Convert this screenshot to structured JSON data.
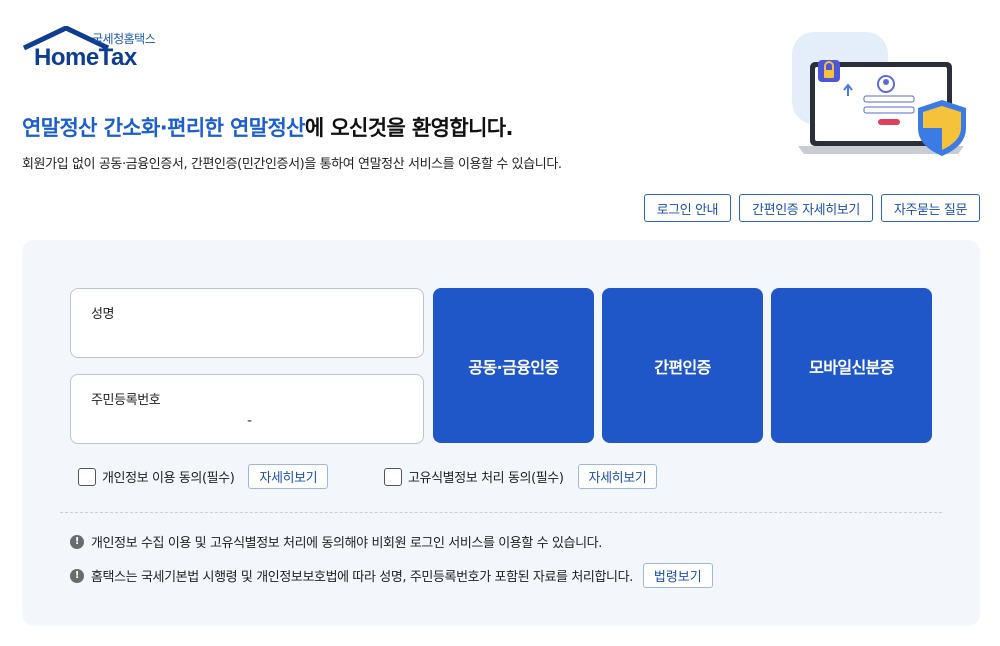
{
  "logo": {
    "sub": "국세청홈택스",
    "main": "HomeTax"
  },
  "header": {
    "headline_accent": "연말정산 간소화·편리한 연말정산",
    "headline_rest": "에 오신것을 환영합니다.",
    "subline": "회원가입 없이 공동·금융인증서, 간편인증(민간인증서)을 통하여 연말정산 서비스를 이용할 수 있습니다."
  },
  "top_buttons": {
    "login_guide": "로그인 안내",
    "simple_auth_detail": "간편인증 자세히보기",
    "faq": "자주묻는 질문"
  },
  "form": {
    "name_label": "성명",
    "rrn_label": "주민등록번호",
    "rrn_separator": "-"
  },
  "auth": {
    "joint": "공동·금융인증",
    "simple": "간편인증",
    "mobile_id": "모바일신분증"
  },
  "agreements": {
    "privacy": "개인정보 이용 동의(필수)",
    "unique_id": "고유식별정보 처리 동의(필수)",
    "detail": "자세히보기"
  },
  "notices": {
    "icon": "!",
    "line1": "개인정보 수집 이용 및 고유식별정보 처리에 동의해야 비회원 로그인 서비스를 이용할 수 있습니다.",
    "line2": "홈택스는 국세기본법 시행령 및 개인정보보호법에 따라 성명, 주민등록번호가 포함된 자료를 처리합니다.",
    "law_button": "법령보기"
  },
  "colors": {
    "primary": "#2057c8",
    "accent_text": "#1b5ed0",
    "panel_bg": "#f3f6fb"
  }
}
